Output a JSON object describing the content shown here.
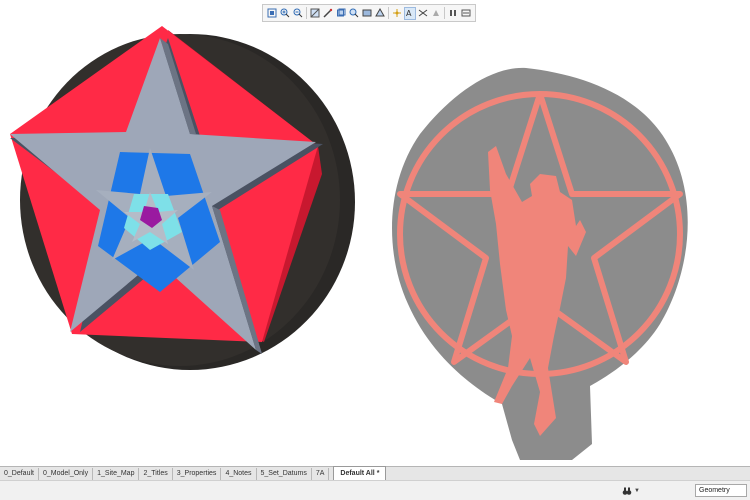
{
  "toolbar": {
    "buttons": [
      {
        "icon": "refit-icon"
      },
      {
        "icon": "zoom-in-icon"
      },
      {
        "icon": "zoom-out-icon"
      },
      {
        "icon": "repaint-icon"
      },
      {
        "icon": "view-manager-icon"
      },
      {
        "icon": "saved-orientations-icon"
      },
      {
        "icon": "zoom-window-icon"
      },
      {
        "icon": "display-style-icon"
      },
      {
        "icon": "perspective-icon"
      },
      {
        "icon": "datum-display-icon"
      },
      {
        "icon": "annotation-display-icon"
      },
      {
        "icon": "section-icon"
      },
      {
        "icon": "appearance-icon"
      },
      {
        "icon": "pause-icon"
      },
      {
        "icon": "spin-center-icon"
      }
    ]
  },
  "tabs": [
    {
      "label": "0_Default"
    },
    {
      "label": "0_Model_Only"
    },
    {
      "label": "1_Site_Map"
    },
    {
      "label": "2_Titles"
    },
    {
      "label": "3_Properties"
    },
    {
      "label": "4_Notes"
    },
    {
      "label": "5_Set_Datums"
    },
    {
      "label": "7A"
    }
  ],
  "active_tab": {
    "label": "Default All *"
  },
  "status": {
    "filter_icon": "binoculars-icon",
    "selection_filter": "Geometry"
  },
  "colors": {
    "disc": "#2a2826",
    "pentagon": "#ff2a46",
    "star": "#9ea7b8",
    "inner_blue": "#1e78e8",
    "inner_cyan": "#7ee0e8",
    "center": "#9a1aa0",
    "decal_grey": "#8c8c8c",
    "decal_red": "#f0857a"
  }
}
